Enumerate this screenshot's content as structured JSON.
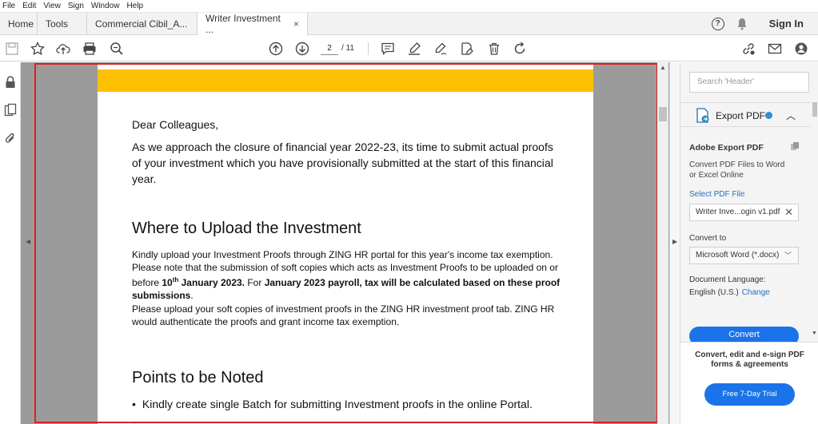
{
  "menu": [
    "File",
    "Edit",
    "View",
    "Sign",
    "Window",
    "Help"
  ],
  "tabs": {
    "home": "Home",
    "tools": "Tools",
    "doc1": "Commercial Cibil_A...",
    "doc2": "Writer Investment ...",
    "close": "×"
  },
  "header": {
    "help": "?",
    "signin": "Sign In"
  },
  "pager": {
    "current": "2",
    "total": "/ 11"
  },
  "document": {
    "greeting": "Dear Colleagues,",
    "intro": "As we approach the closure of financial year 2022-23, its time to submit actual proofs of your investment which you have provisionally submitted at the start of this financial year.",
    "heading1": "Where to Upload the Investment",
    "p1a": "Kindly upload your Investment Proofs through ZING HR portal for this year's income tax exemption. Please note that the submission of soft copies which acts as Investment Proofs to be uploaded on or before ",
    "p1_day": "10",
    "p1_sup": "th",
    "p1_month": " January 2023.",
    "p1b": " For ",
    "p1_bold": "January 2023 payroll, tax will be calculated based on these proof submissions",
    "p1_end": ".",
    "p2": "Please upload your soft copies of investment proofs in the ZING HR investment proof tab. ZING HR would authenticate the proofs and grant income tax exemption.",
    "heading2": "Points to be Noted",
    "bullet1": "Kindly create single Batch for submitting Investment proofs in the online Portal.",
    "bullet_mark": "•"
  },
  "panel": {
    "search_placeholder": "Search 'Header'",
    "export_title": "Export PDF",
    "section_title": "Adobe Export PDF",
    "desc": "Convert PDF Files to Word or Excel Online",
    "select_label": "Select PDF File",
    "file_name": "Writer Inve...ogin v1.pdf",
    "convert_to_label": "Convert to",
    "convert_to_value": "Microsoft Word (*.docx)",
    "lang_label": "Document Language:",
    "lang_value": "English (U.S.)",
    "lang_change": "Change",
    "convert_button": "Convert",
    "promo": "Convert, edit and e-sign PDF forms & agreements",
    "trial_button": "Free 7-Day Trial"
  },
  "colors": {
    "accent": "#1a73e8",
    "banner": "#ffc000",
    "highlight_frame": "#e0201f"
  }
}
